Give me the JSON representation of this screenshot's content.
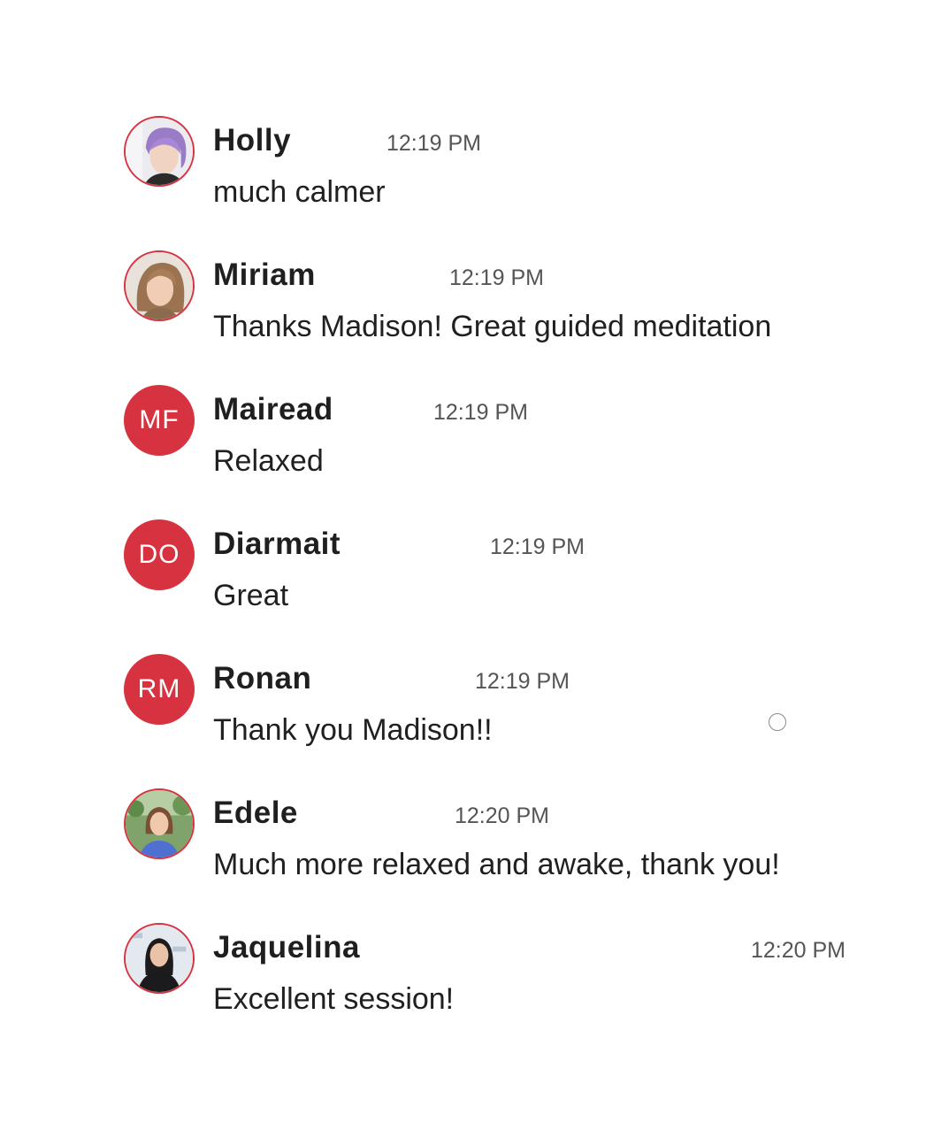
{
  "messages": [
    {
      "sender": "Holly",
      "time": "12:19 PM",
      "text": "much calmer",
      "avatar": {
        "type": "photo",
        "icon": "holly-avatar-photo"
      }
    },
    {
      "sender": "Miriam",
      "time": "12:19 PM",
      "text": "Thanks Madison! Great guided meditation",
      "avatar": {
        "type": "photo",
        "icon": "miriam-avatar-photo"
      }
    },
    {
      "sender": "Mairead",
      "time": "12:19 PM",
      "text": "Relaxed",
      "avatar": {
        "type": "initials",
        "initials": "MF"
      }
    },
    {
      "sender": "Diarmait",
      "time": "12:19 PM",
      "text": "Great",
      "avatar": {
        "type": "initials",
        "initials": "DO"
      }
    },
    {
      "sender": "Ronan",
      "time": "12:19 PM",
      "text": "Thank you Madison!!",
      "avatar": {
        "type": "initials",
        "initials": "RM"
      }
    },
    {
      "sender": "Edele",
      "time": "12:20 PM",
      "text": "Much more relaxed and awake, thank you!",
      "avatar": {
        "type": "photo",
        "icon": "edele-avatar-photo"
      }
    },
    {
      "sender": "Jaquelina",
      "time": "12:20 PM",
      "text": "Excellent session!",
      "avatar": {
        "type": "photo",
        "icon": "jaquelina-avatar-photo"
      }
    }
  ],
  "colors": {
    "accent": "#d6323f",
    "text": "#202020",
    "timestamp": "#555555",
    "background": "#ffffff"
  },
  "status_indicator": {
    "icon": "empty-circle-icon"
  }
}
